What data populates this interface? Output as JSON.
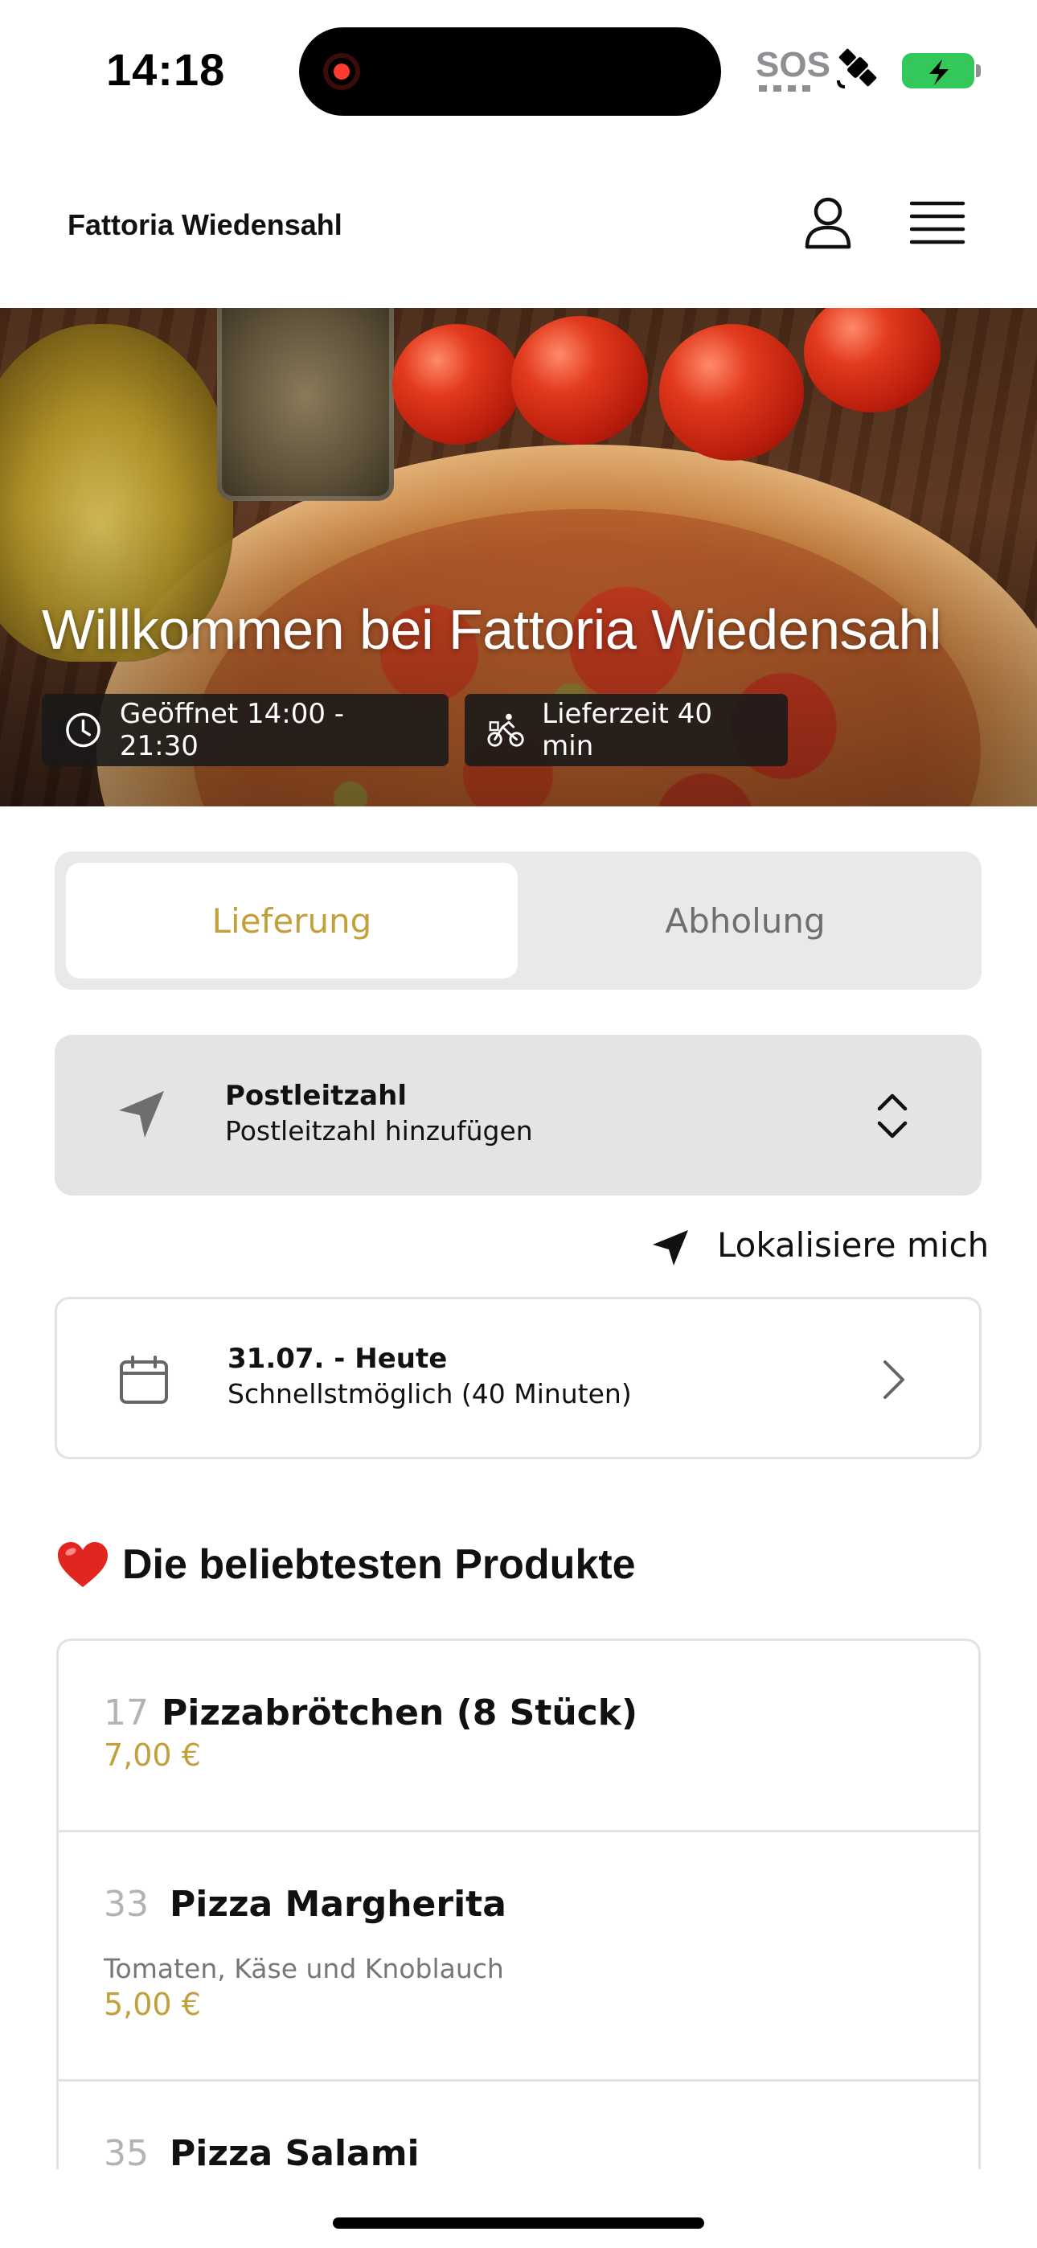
{
  "status_bar": {
    "time": "14:18",
    "sos": "SOS",
    "icons": [
      "recording-indicator-icon",
      "satellite-icon",
      "battery-charging-icon"
    ]
  },
  "header": {
    "brand": "Fattoria Wiedensahl",
    "icons": [
      "account-icon",
      "hamburger-menu-icon"
    ]
  },
  "hero": {
    "title": "Willkommen bei Fattoria Wiedensahl",
    "open_hours": "Geöffnet 14:00 - 21:30",
    "delivery_time": "Lieferzeit 40 min",
    "icons": [
      "clock-icon",
      "cyclist-icon"
    ]
  },
  "mode": {
    "options": [
      "Lieferung",
      "Abholung"
    ],
    "selected": "Lieferung",
    "accent_color": "#c2a03c"
  },
  "postcode": {
    "title": "Postleitzahl",
    "placeholder": "Postleitzahl hinzufügen"
  },
  "locate": {
    "label": "Lokalisiere mich"
  },
  "date": {
    "title": "31.07. - Heute",
    "subtitle": "Schnellstmöglich (40 Minuten)"
  },
  "popular": {
    "heading": "Die beliebtesten Produkte",
    "products": [
      {
        "number": "17",
        "name": "Pizzabrötchen (8 Stück)",
        "description": "",
        "price": "7,00 €"
      },
      {
        "number": "33",
        "name": "Pizza Margherita",
        "description": "Tomaten, Käse und Knoblauch",
        "price": "5,00 €"
      },
      {
        "number": "35",
        "name": "Pizza Salami",
        "description": "",
        "price": ""
      }
    ]
  }
}
